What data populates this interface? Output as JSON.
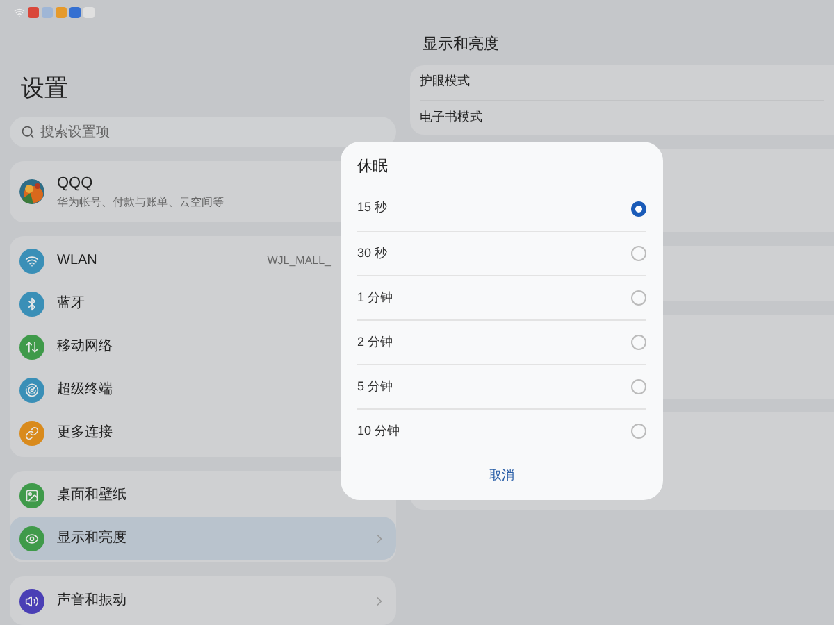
{
  "sidebar": {
    "title": "设置",
    "search": {
      "placeholder": "搜索设置项"
    },
    "account": {
      "name": "QQQ",
      "subtitle": "华为帐号、付款与账单、云空间等"
    },
    "groups": [
      [
        {
          "label": "WLAN",
          "value": "WJL_MALL_",
          "color": "#3a8fb7",
          "selected": false
        },
        {
          "label": "蓝牙",
          "color": "#3a8fb7",
          "selected": false
        },
        {
          "label": "移动网络",
          "color": "#3f9a4a",
          "selected": false
        },
        {
          "label": "超级终端",
          "color": "#3a8fb7",
          "selected": false
        },
        {
          "label": "更多连接",
          "color": "#d98a1c",
          "selected": false
        }
      ],
      [
        {
          "label": "桌面和壁纸",
          "color": "#3f9a4a",
          "selected": false
        },
        {
          "label": "显示和亮度",
          "color": "#3f9a4a",
          "selected": true
        }
      ],
      [
        {
          "label": "声音和振动",
          "color": "#4a3fb5",
          "selected": false
        }
      ]
    ]
  },
  "detail": {
    "title": "显示和亮度",
    "rows": [
      "护眼模式",
      "电子书模式"
    ]
  },
  "dialog": {
    "title": "休眠",
    "options": [
      {
        "label": "15 秒",
        "selected": true
      },
      {
        "label": "30 秒",
        "selected": false
      },
      {
        "label": "1 分钟",
        "selected": false
      },
      {
        "label": "2 分钟",
        "selected": false
      },
      {
        "label": "5 分钟",
        "selected": false
      },
      {
        "label": "10 分钟",
        "selected": false
      }
    ],
    "cancel": "取消"
  }
}
